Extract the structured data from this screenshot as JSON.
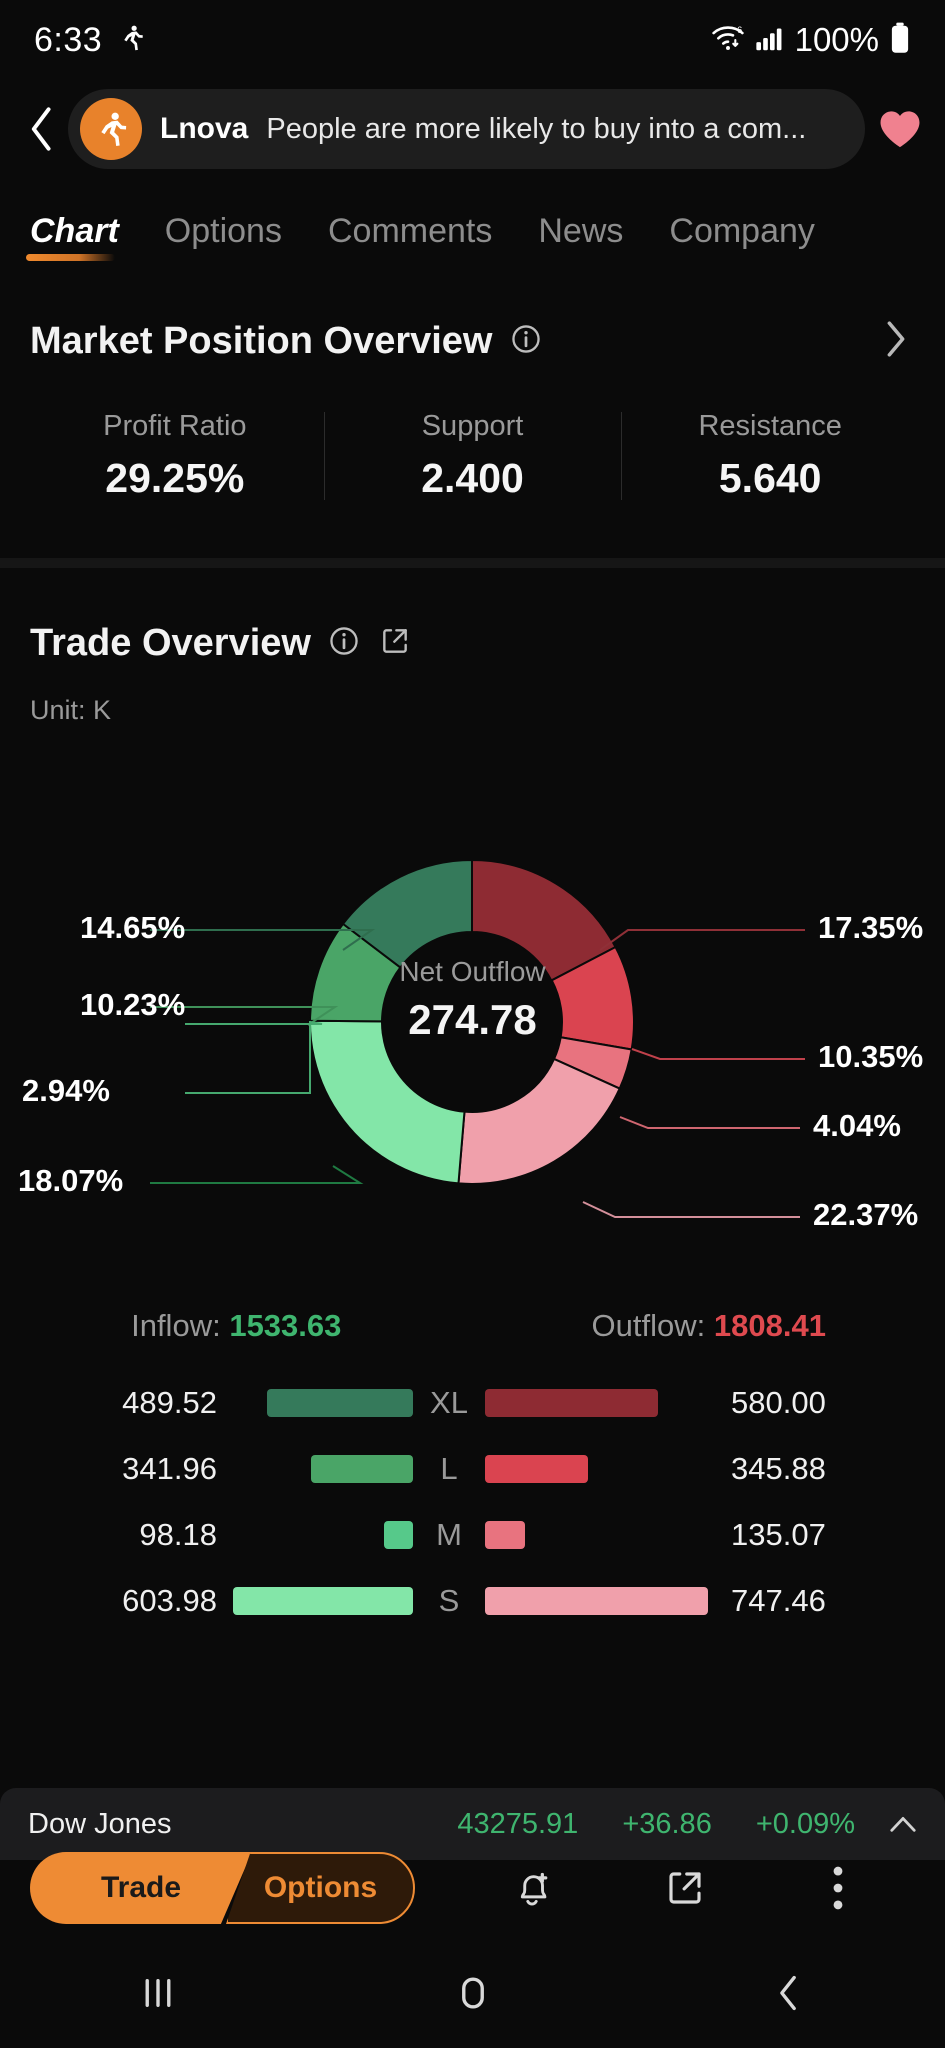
{
  "status_bar": {
    "time": "6:33",
    "battery_percent": "100%",
    "icons": [
      "running-person-icon",
      "wifi-icon",
      "cellular-signal-icon",
      "battery-icon"
    ]
  },
  "banner": {
    "back_icon": "back-chevron-icon",
    "avatar_icon": "lnova-avatar-icon",
    "author": "Lnova",
    "headline": "People are more likely to buy into a com...",
    "like_icon": "heart-icon"
  },
  "tabs": [
    {
      "label": "Chart",
      "active": true
    },
    {
      "label": "Options",
      "active": false
    },
    {
      "label": "Comments",
      "active": false
    },
    {
      "label": "News",
      "active": false
    },
    {
      "label": "Company",
      "active": false
    }
  ],
  "market_position": {
    "title": "Market Position Overview",
    "info_icon": "info-icon",
    "chevron_icon": "chevron-right-icon",
    "stats": [
      {
        "label": "Profit Ratio",
        "value": "29.25%"
      },
      {
        "label": "Support",
        "value": "2.400"
      },
      {
        "label": "Resistance",
        "value": "5.640"
      }
    ]
  },
  "trade_overview": {
    "title": "Trade Overview",
    "info_icon": "info-icon",
    "share_icon": "share-icon",
    "unit": "Unit: K",
    "center_label": "Net Outflow",
    "center_value": "274.78",
    "inflow_label": "Inflow:",
    "inflow_value": "1533.63",
    "outflow_label": "Outflow:",
    "outflow_value": "1808.41",
    "colors": {
      "inflow_xl": "#357a5b",
      "inflow_l": "#4aa567",
      "inflow_m": "#56c98a",
      "inflow_s": "#83e6a8",
      "outflow_xl": "#8e2b33",
      "outflow_l": "#da4450",
      "outflow_m": "#e8737f",
      "outflow_s": "#f0a0ab",
      "inflow_text": "#3fb56f",
      "outflow_text": "#df4a4f"
    },
    "rows": [
      {
        "category": "XL",
        "inflow": "489.52",
        "outflow": "580.00"
      },
      {
        "category": "L",
        "inflow": "341.96",
        "outflow": "345.88"
      },
      {
        "category": "M",
        "inflow": "98.18",
        "outflow": "135.07"
      },
      {
        "category": "S",
        "inflow": "603.98",
        "outflow": "747.46"
      }
    ]
  },
  "chart_data": {
    "type": "pie",
    "title": "Trade Overview",
    "subtitle": "Unit: K",
    "center_label": "Net Outflow",
    "center_value": 274.78,
    "total_inflow": 1533.63,
    "total_outflow": 1808.41,
    "legend_position": "bottom",
    "labels": [
      "XL Outflow",
      "L Outflow",
      "M Outflow",
      "S Outflow",
      "S Inflow",
      "M Inflow",
      "L Inflow",
      "XL Inflow"
    ],
    "percent_labels": [
      "17.35%",
      "10.35%",
      "4.04%",
      "22.37%",
      "18.07%",
      "2.94%",
      "10.23%",
      "14.65%"
    ],
    "values": [
      17.35,
      10.35,
      4.04,
      22.37,
      18.07,
      2.94,
      10.23,
      14.65
    ],
    "amounts": [
      580.0,
      345.88,
      135.07,
      747.46,
      603.98,
      98.18,
      341.96,
      489.52
    ],
    "colors": [
      "#8e2b33",
      "#da4450",
      "#e8737f",
      "#f0a0ab",
      "#83e6a8",
      "#56c98a",
      "#4aa567",
      "#357a5b"
    ]
  },
  "ticker": {
    "name": "Dow Jones",
    "price": "43275.91",
    "change": "+36.86",
    "change_percent": "+0.09%",
    "caret_icon": "chevron-up-icon",
    "color": "#3fb56f"
  },
  "action_bar": {
    "trade_label": "Trade",
    "options_label": "Options",
    "icons": [
      "alarm-add-icon",
      "share-icon",
      "more-vertical-icon"
    ]
  },
  "nav_bar": {
    "icons": [
      "recents-icon",
      "home-icon",
      "back-icon"
    ]
  }
}
